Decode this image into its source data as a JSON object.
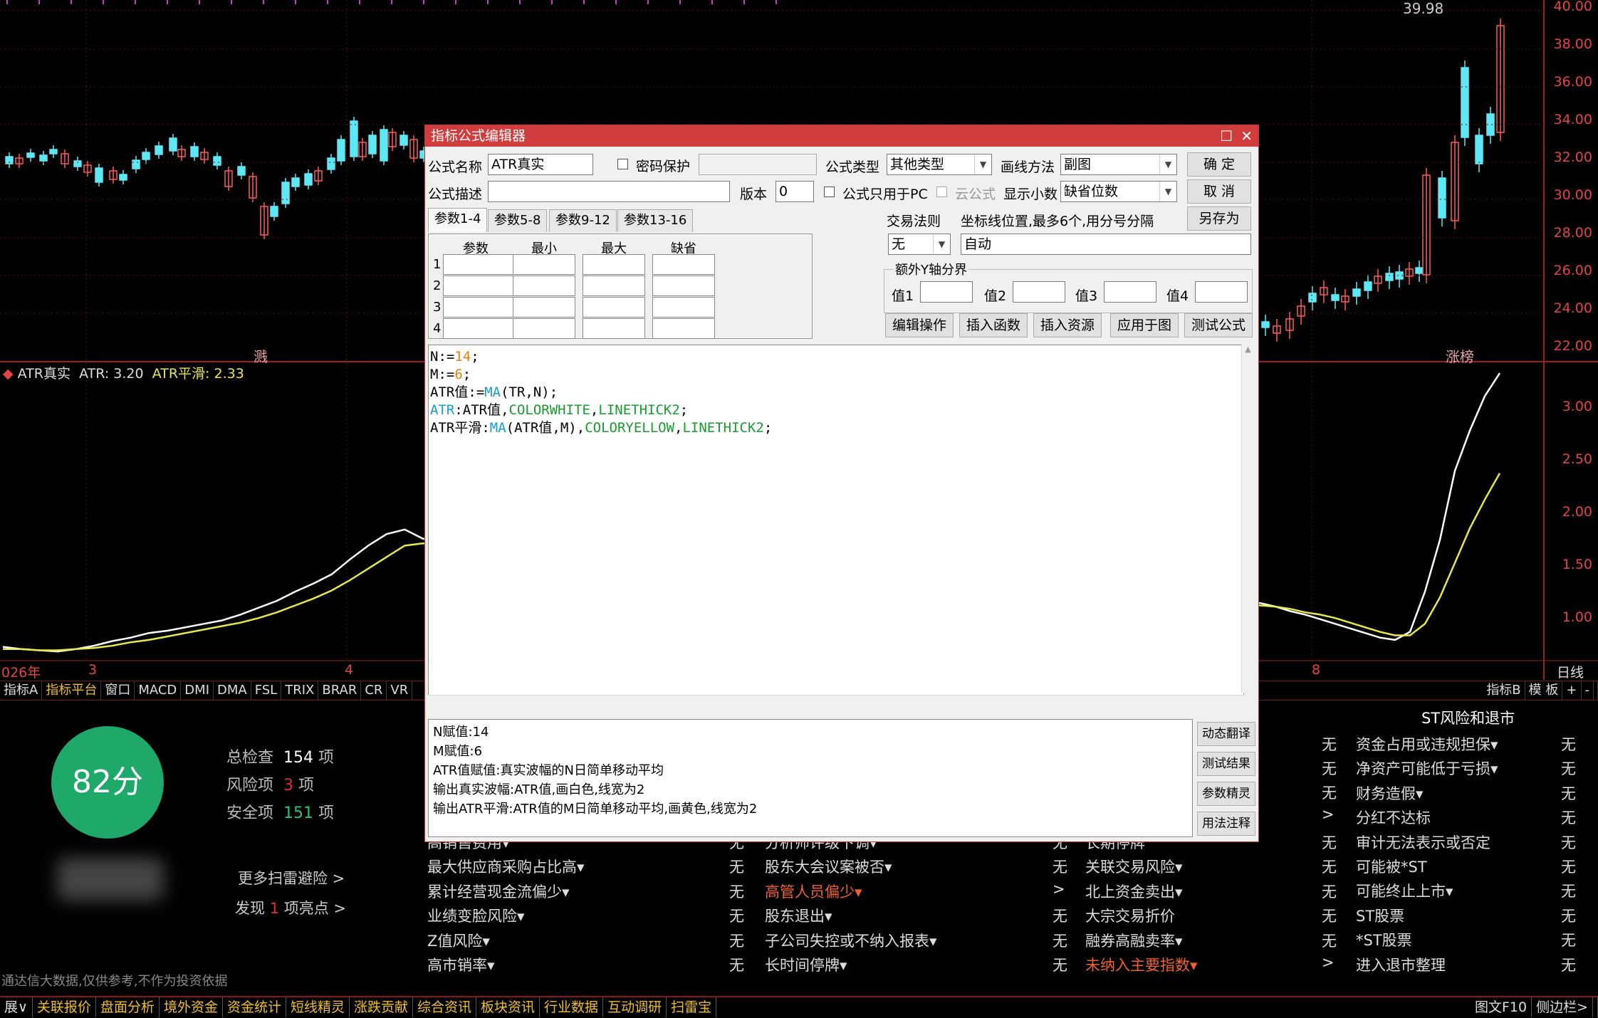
{
  "main_chart": {
    "price_high_label": "39.98",
    "price_axis": [
      "40.00",
      "38.00",
      "36.00",
      "34.00",
      "32.00",
      "30.00",
      "28.00",
      "26.00",
      "24.00",
      "22.00"
    ],
    "tags": [
      "溅",
      "涨榜"
    ]
  },
  "indicator": {
    "name": "ATR真实",
    "atr": "ATR: 3.20",
    "smooth": "ATR平滑: 2.33",
    "axis": [
      "3.00",
      "2.50",
      "2.00",
      "1.50",
      "1.00"
    ]
  },
  "date_axis": {
    "items": [
      "026年",
      "3",
      "4",
      "8"
    ],
    "right_label": "日线"
  },
  "tabbar": {
    "tabs": [
      "指标A",
      "指标平台",
      "窗口",
      "MACD",
      "DMI",
      "DMA",
      "FSL",
      "TRIX",
      "BRAR",
      "CR",
      "VR"
    ],
    "active_index": 1,
    "right": [
      "指标B",
      "模 板",
      "+",
      "-"
    ]
  },
  "dialog": {
    "title": "指标公式编辑器",
    "formula_name_label": "公式名称",
    "formula_name": "ATR真实",
    "password_label": "密码保护",
    "formula_type_label": "公式类型",
    "formula_type": "其他类型",
    "draw_method_label": "画线方法",
    "draw_method": "副图",
    "ok": "确  定",
    "cancel": "取  消",
    "save_as": "另存为",
    "desc_label": "公式描述",
    "version_label": "版本",
    "version": "0",
    "pc_only_label": "公式只用于PC",
    "cloud_label": "云公式",
    "decimal_label": "显示小数",
    "decimal": "缺省位数",
    "param_tabs": [
      "参数1-4",
      "参数5-8",
      "参数9-12",
      "参数13-16"
    ],
    "param_headers": [
      "参数",
      "最小",
      "最大",
      "缺省"
    ],
    "row_nums": [
      "1",
      "2",
      "3",
      "4"
    ],
    "trade_rule_label": "交易法则",
    "trade_rule": "无",
    "axis_pos_label": "坐标线位置,最多6个,用分号分隔",
    "axis_pos": "自动",
    "extra_y_label": "额外Y轴分界",
    "val_labels": [
      "值1",
      "值2",
      "值3",
      "值4"
    ],
    "tool_buttons": [
      "编辑操作",
      "插入函数",
      "插入资源",
      "应用于图",
      "测试公式"
    ],
    "code": [
      [
        [
          "N",
          "blk"
        ],
        [
          ":=",
          "blk"
        ],
        [
          "14",
          "org"
        ],
        [
          ";",
          "blk"
        ]
      ],
      [
        [
          "M",
          "blk"
        ],
        [
          ":=",
          "blk"
        ],
        [
          "6",
          "org"
        ],
        [
          ";",
          "blk"
        ]
      ],
      [
        [
          "ATR值",
          "blk"
        ],
        [
          ":=",
          "blk"
        ],
        [
          "MA",
          "cyan"
        ],
        [
          "(TR,N);",
          "blk"
        ]
      ],
      [
        [
          "ATR",
          "cyan"
        ],
        [
          ":ATR值,",
          "blk"
        ],
        [
          "COLORWHITE",
          "grn"
        ],
        [
          ",",
          "blk"
        ],
        [
          "LINETHICK2",
          "grn"
        ],
        [
          ";",
          "blk"
        ]
      ],
      [
        [
          "ATR平滑",
          "blk"
        ],
        [
          ":",
          "blk"
        ],
        [
          "MA",
          "cyan"
        ],
        [
          "(ATR值,M),",
          "blk"
        ],
        [
          "COLORYELLOW",
          "grn"
        ],
        [
          ",",
          "blk"
        ],
        [
          "LINETHICK2",
          "grn"
        ],
        [
          ";",
          "blk"
        ]
      ]
    ],
    "desc_lines": [
      "N赋值:14",
      "M赋值:6",
      "ATR值赋值:真实波幅的N日简单移动平均",
      "输出真实波幅:ATR值,画白色,线宽为2",
      "输出ATR平滑:ATR值的M日简单移动平均,画黄色,线宽为2"
    ],
    "side_buttons": [
      "动态翻译",
      "测试结果",
      "参数精灵",
      "用法注释"
    ]
  },
  "scan": {
    "score": "82分",
    "total_label": "总检查",
    "total": "154",
    "total_unit": "项",
    "risk_label": "风险项",
    "risk": "3",
    "risk_unit": "项",
    "safe_label": "安全项",
    "safe": "151",
    "safe_unit": "项",
    "more": "更多扫雷避险 >",
    "found_prefix": "发现",
    "found": "1",
    "found_suffix": "项亮点 >",
    "disclaimer": "通达信大数据,仅供参考,不作为投资依据"
  },
  "risk_cols": {
    "col1": [
      {
        "name": "高销售费用▾",
        "val": "无",
        "red": false
      },
      {
        "name": "最大供应商采购占比高▾",
        "val": "无",
        "red": false
      },
      {
        "name": "累计经营现金流偏少▾",
        "val": "无",
        "red": false
      },
      {
        "name": "业绩变脸风险▾",
        "val": "无",
        "red": false
      },
      {
        "name": "Z值风险▾",
        "val": "无",
        "red": false
      },
      {
        "name": "高市销率▾",
        "val": "无",
        "red": false
      }
    ],
    "col2": [
      {
        "name": "分析师评级下调▾",
        "val": "无",
        "red": false
      },
      {
        "name": "股东大会议案被否▾",
        "val": "无",
        "red": false
      },
      {
        "name": "高管人员偏少▾",
        "val": ">",
        "red": true
      },
      {
        "name": "股东退出▾",
        "val": "无",
        "red": false
      },
      {
        "name": "子公司失控或不纳入报表▾",
        "val": "无",
        "red": false
      },
      {
        "name": "长时间停牌▾",
        "val": "无",
        "red": false
      }
    ],
    "col3_top": [
      "无",
      "无",
      "无",
      ">"
    ],
    "col3": [
      {
        "name": "长期停牌",
        "val": "无",
        "red": false
      },
      {
        "name": "关联交易风险▾",
        "val": "无",
        "red": false
      },
      {
        "name": "北上资金卖出▾",
        "val": "无",
        "red": false
      },
      {
        "name": "大宗交易折价",
        "val": "无",
        "red": false
      },
      {
        "name": "融券高融卖率▾",
        "val": "无",
        "red": false
      },
      {
        "name": "未纳入主要指数▾",
        "val": ">",
        "red": true
      }
    ],
    "col4_title": "ST风险和退市",
    "col4": [
      {
        "name": "资金占用或违规担保▾",
        "val": "无"
      },
      {
        "name": "净资产可能低于亏损▾",
        "val": "无"
      },
      {
        "name": "财务造假▾",
        "val": "无"
      },
      {
        "name": "分红不达标",
        "val": "无"
      },
      {
        "name": "审计无法表示或否定",
        "val": "无"
      },
      {
        "name": "可能被*ST",
        "val": "无"
      },
      {
        "name": "可能终止上市▾",
        "val": "无"
      },
      {
        "name": "ST股票",
        "val": "无"
      },
      {
        "name": "*ST股票",
        "val": "无"
      },
      {
        "name": "进入退市整理",
        "val": "无"
      }
    ]
  },
  "bottombar": {
    "items": [
      "展∨",
      "关联报价",
      "盘面分析",
      "境外资金",
      "资金统计",
      "短线精灵",
      "涨跌贡献",
      "综合资讯",
      "板块资讯",
      "行业数据",
      "互动调研",
      "扫雷宝"
    ],
    "right": [
      "图文F10",
      "侧边栏>"
    ]
  },
  "chart_data": {
    "type": "line",
    "title": "ATR真实",
    "series": [
      {
        "name": "ATR",
        "values": [
          0.82,
          0.8,
          0.79,
          0.78,
          0.8,
          0.83,
          0.87,
          0.9,
          0.94,
          0.96,
          0.99,
          1.02,
          1.05,
          1.1,
          1.16,
          1.22,
          1.3,
          1.37,
          1.45,
          1.58,
          1.7,
          1.8,
          1.84,
          1.76,
          1.2,
          1.17,
          1.13,
          1.1,
          1.06,
          1.02,
          0.98,
          0.94,
          0.9,
          0.88,
          0.95,
          1.3,
          1.75,
          2.35,
          2.7,
          3.0,
          3.2
        ]
      },
      {
        "name": "ATR平滑",
        "values": [
          0.8,
          0.8,
          0.79,
          0.79,
          0.8,
          0.81,
          0.83,
          0.86,
          0.88,
          0.91,
          0.94,
          0.97,
          1.0,
          1.03,
          1.07,
          1.12,
          1.18,
          1.24,
          1.31,
          1.4,
          1.5,
          1.6,
          1.7,
          1.72,
          1.18,
          1.17,
          1.15,
          1.12,
          1.1,
          1.07,
          1.03,
          0.99,
          0.95,
          0.92,
          0.92,
          1.02,
          1.25,
          1.55,
          1.85,
          2.1,
          2.33
        ]
      }
    ],
    "ylim": [
      0.7,
      3.3
    ]
  }
}
